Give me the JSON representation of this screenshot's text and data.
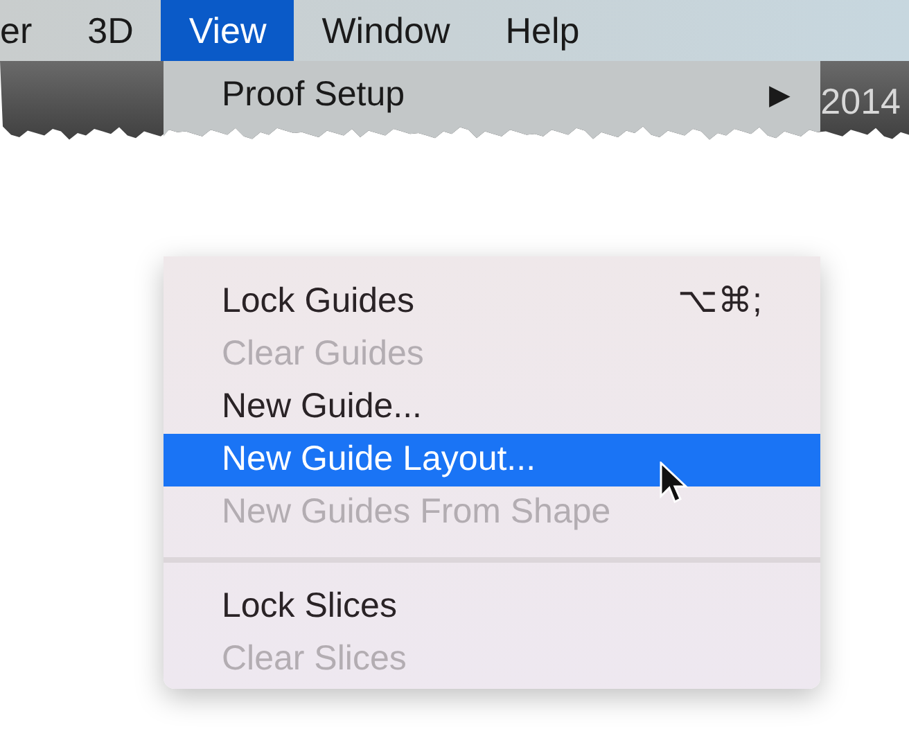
{
  "menu_bar": [
    {
      "label": "er",
      "selected": false
    },
    {
      "label": "3D",
      "selected": false
    },
    {
      "label": "View",
      "selected": true
    },
    {
      "label": "Window",
      "selected": false
    },
    {
      "label": "Help",
      "selected": false
    }
  ],
  "toolbar": {
    "text": "2014"
  },
  "menu_top": [
    {
      "label": "Proof Setup",
      "submenu_arrow": "▶"
    }
  ],
  "menu_items": [
    {
      "kind": "item",
      "label": "Lock Guides",
      "shortcut": "⌥⌘;",
      "disabled": false,
      "selected": false
    },
    {
      "kind": "item",
      "label": "Clear Guides",
      "disabled": true,
      "selected": false
    },
    {
      "kind": "item",
      "label": "New Guide...",
      "disabled": false,
      "selected": false
    },
    {
      "kind": "item",
      "label": "New Guide Layout...",
      "disabled": false,
      "selected": true
    },
    {
      "kind": "item",
      "label": "New Guides From Shape",
      "disabled": true,
      "selected": false
    },
    {
      "kind": "separator"
    },
    {
      "kind": "item",
      "label": "Lock Slices",
      "disabled": false,
      "selected": false
    },
    {
      "kind": "item",
      "label": "Clear Slices",
      "disabled": true,
      "selected": false
    }
  ]
}
